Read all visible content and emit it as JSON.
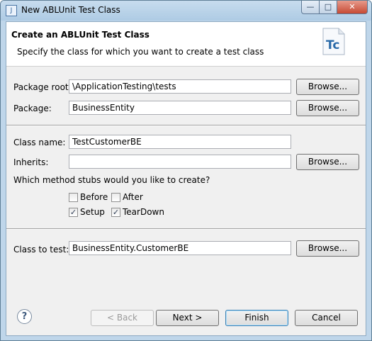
{
  "window": {
    "title": "New ABLUnit Test Class",
    "controls": {
      "minimize": "—",
      "maximize": "□",
      "close": "✕"
    }
  },
  "header": {
    "title": "Create an ABLUnit Test Class",
    "subtitle": "Specify the class for which you want to create a test class",
    "logo_text": "Tc"
  },
  "form": {
    "package_root": {
      "label": "Package root:",
      "value": "\\ApplicationTesting\\tests",
      "browse": "Browse..."
    },
    "package": {
      "label": "Package:",
      "value": "BusinessEntity",
      "browse": "Browse..."
    },
    "class_name": {
      "label": "Class name:",
      "value": "TestCustomerBE"
    },
    "inherits": {
      "label": "Inherits:",
      "value": "",
      "browse": "Browse..."
    },
    "method_stubs": {
      "question": "Which method stubs would you like to create?",
      "before": {
        "label": "Before",
        "checked": false
      },
      "after": {
        "label": "After",
        "checked": false
      },
      "setup": {
        "label": "Setup",
        "checked": true
      },
      "teardown": {
        "label": "TearDown",
        "checked": true
      }
    },
    "class_to_test": {
      "label": "Class to test:",
      "value": "BusinessEntity.CustomerBE",
      "browse": "Browse..."
    }
  },
  "footer": {
    "help": "?",
    "back": "< Back",
    "next": "Next >",
    "finish": "Finish",
    "cancel": "Cancel"
  }
}
